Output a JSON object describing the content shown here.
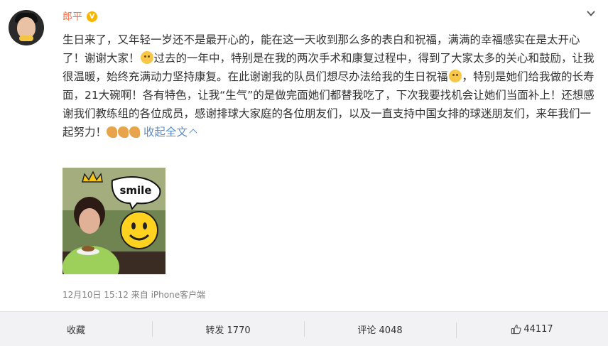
{
  "user": {
    "name": "郎平",
    "badge": "V"
  },
  "post": {
    "text": "生日来了，又年轻一岁还不是最开心的，能在这一天收到那么多的表白和祝福，满满的幸福感实在是太开心了！谢谢大家！",
    "text2": "过去的一年中，特别是在我的两次手术和康复过程中，得到了大家太多的关心和鼓励，让我很温暖，始终充满动力坚持康复。在此谢谢我的队员们想尽办法给我的生日祝福",
    "text3": "，特别是她们给我做的长寿面，21大碗啊！各有特色，让我“生气”的是做完面她们都替我吃了，下次我要找机会让她们当面补上！还想感谢我们教练组的各位成员，感谢排球大家庭的各位朋友们，以及一直支持中国女排的球迷朋友们，来年我们一起努力！",
    "collapse_label": "收起全文",
    "photo_text": "smile",
    "timestamp": "12月10日 15:12",
    "source": "来自 iPhone客户端"
  },
  "actions": {
    "favorite": "收藏",
    "repost": "转发 1770",
    "comment": "评论 4048",
    "like": "44117"
  },
  "colors": {
    "username": "#eb7350",
    "link": "#5b8dc9",
    "badge": "#f7b500"
  }
}
